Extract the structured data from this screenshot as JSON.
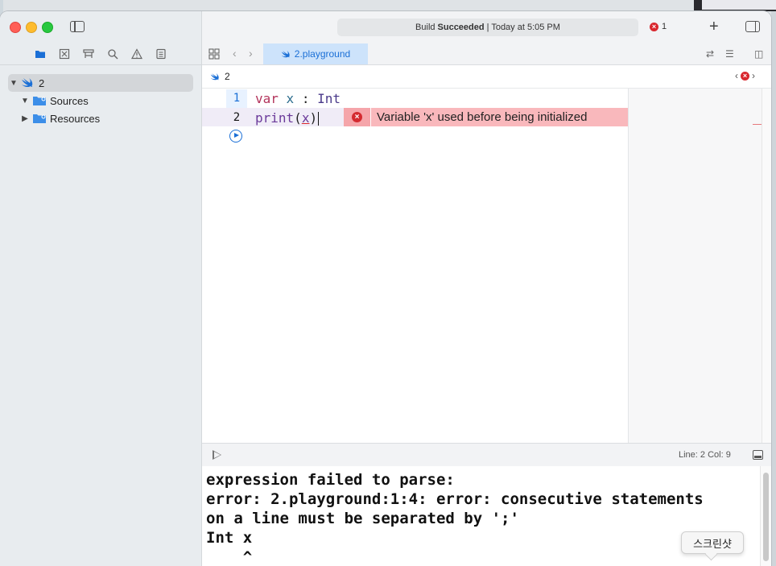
{
  "toolbar": {
    "status_prefix": "Build",
    "status_bold": "Succeeded",
    "status_suffix": "| Today at 5:05 PM",
    "error_count": "1",
    "add_label": "+"
  },
  "navigator": {
    "icons": [
      "folder-icon",
      "source-control-icon",
      "symbol-icon",
      "search-icon",
      "warning-icon",
      "report-icon"
    ],
    "tree": [
      {
        "label": "2",
        "type": "playground",
        "expanded": true,
        "selected": true
      },
      {
        "label": "Sources",
        "type": "folder",
        "expanded": true
      },
      {
        "label": "Resources",
        "type": "folder",
        "expanded": false
      }
    ]
  },
  "tabs": [
    {
      "label": "2.playground",
      "active": true
    }
  ],
  "jumpbar": {
    "item": "2"
  },
  "editor": {
    "line_numbers": [
      "1",
      "2"
    ],
    "line1": {
      "kw": "var",
      "name": "x",
      "colon": " : ",
      "type": "Int"
    },
    "line2": {
      "fn": "print",
      "open": "(",
      "arg": "x",
      "close": ")"
    },
    "error_message": "Variable 'x' used before being initialized"
  },
  "debug": {
    "linecol": "Line: 2  Col: 9"
  },
  "console": {
    "lines": [
      "expression failed to parse:",
      "error: 2.playground:1:4: error: consecutive statements",
      "on a line must be separated by ';'",
      "Int x",
      "    ^"
    ]
  },
  "tooltip": {
    "label": "스크린샷"
  },
  "colors": {
    "accent": "#1a6fd6",
    "error": "#d9272e",
    "error_banner": "#f9b8bc"
  }
}
